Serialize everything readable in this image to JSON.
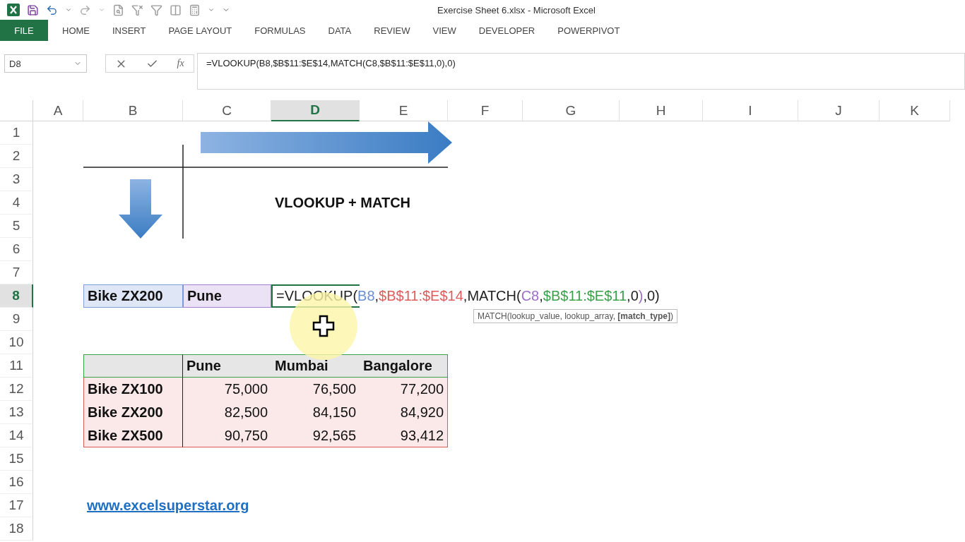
{
  "window": {
    "title": "Exercise Sheet 6.xlsx - Microsoft Excel"
  },
  "ribbon_tabs": [
    {
      "label": "FILE",
      "kind": "file"
    },
    {
      "label": "HOME",
      "kind": "tab"
    },
    {
      "label": "INSERT",
      "kind": "tab"
    },
    {
      "label": "PAGE LAYOUT",
      "kind": "tab"
    },
    {
      "label": "FORMULAS",
      "kind": "tab"
    },
    {
      "label": "DATA",
      "kind": "tab"
    },
    {
      "label": "REVIEW",
      "kind": "tab"
    },
    {
      "label": "VIEW",
      "kind": "tab"
    },
    {
      "label": "DEVELOPER",
      "kind": "tab"
    },
    {
      "label": "POWERPIVOT",
      "kind": "tab"
    }
  ],
  "formula_bar": {
    "name_box": "D8",
    "fx_label": "fx",
    "formula": "=VLOOKUP(B8,$B$11:$E$14,MATCH(C8,$B$11:$E$11,0),0)"
  },
  "columns": [
    {
      "label": "A",
      "selected": false
    },
    {
      "label": "B",
      "selected": false
    },
    {
      "label": "C",
      "selected": false
    },
    {
      "label": "D",
      "selected": true
    },
    {
      "label": "E",
      "selected": false
    },
    {
      "label": "F",
      "selected": false
    },
    {
      "label": "G",
      "selected": false
    },
    {
      "label": "H",
      "selected": false
    },
    {
      "label": "I",
      "selected": false
    },
    {
      "label": "J",
      "selected": false
    },
    {
      "label": "K",
      "selected": false
    }
  ],
  "rows": [
    {
      "label": "1",
      "selected": false
    },
    {
      "label": "2",
      "selected": false
    },
    {
      "label": "3",
      "selected": false
    },
    {
      "label": "4",
      "selected": false
    },
    {
      "label": "5",
      "selected": false
    },
    {
      "label": "6",
      "selected": false
    },
    {
      "label": "7",
      "selected": false
    },
    {
      "label": "8",
      "selected": true
    },
    {
      "label": "9",
      "selected": false
    },
    {
      "label": "10",
      "selected": false
    },
    {
      "label": "11",
      "selected": false
    },
    {
      "label": "12",
      "selected": false
    },
    {
      "label": "13",
      "selected": false
    },
    {
      "label": "14",
      "selected": false
    },
    {
      "label": "15",
      "selected": false
    },
    {
      "label": "16",
      "selected": false
    },
    {
      "label": "17",
      "selected": false
    },
    {
      "label": "18",
      "selected": false
    }
  ],
  "heading": "VLOOKUP + MATCH",
  "lookup": {
    "product": "Bike ZX200",
    "city": "Pune"
  },
  "formula_segments": [
    {
      "text": "=VLOOKUP(",
      "color": "#222222"
    },
    {
      "text": "B8",
      "color": "#6b8fd6"
    },
    {
      "text": ",",
      "color": "#222222"
    },
    {
      "text": "$B$11:$E$14",
      "color": "#e05a5a"
    },
    {
      "text": ",MATCH(",
      "color": "#222222"
    },
    {
      "text": "C8",
      "color": "#9a6fc8"
    },
    {
      "text": ",",
      "color": "#222222"
    },
    {
      "text": "$B$11:$E$11",
      "color": "#3aa04a"
    },
    {
      "text": ",0",
      "color": "#222222"
    },
    {
      "text": ")",
      "color": "#9a6fc8"
    },
    {
      "text": ",0)",
      "color": "#222222"
    }
  ],
  "tooltip": "MATCH(lookup_value, lookup_array, **[match_type]**)",
  "table": {
    "columns": [
      "Pune",
      "Mumbai",
      "Bangalore"
    ],
    "rows": [
      {
        "name": "Bike ZX100",
        "values": [
          "75,000",
          "76,500",
          "77,200"
        ]
      },
      {
        "name": "Bike ZX200",
        "values": [
          "82,500",
          "84,150",
          "84,920"
        ]
      },
      {
        "name": "Bike ZX500",
        "values": [
          "90,750",
          "92,565",
          "93,412"
        ]
      }
    ]
  },
  "link": "www.excelsuperstar.org"
}
